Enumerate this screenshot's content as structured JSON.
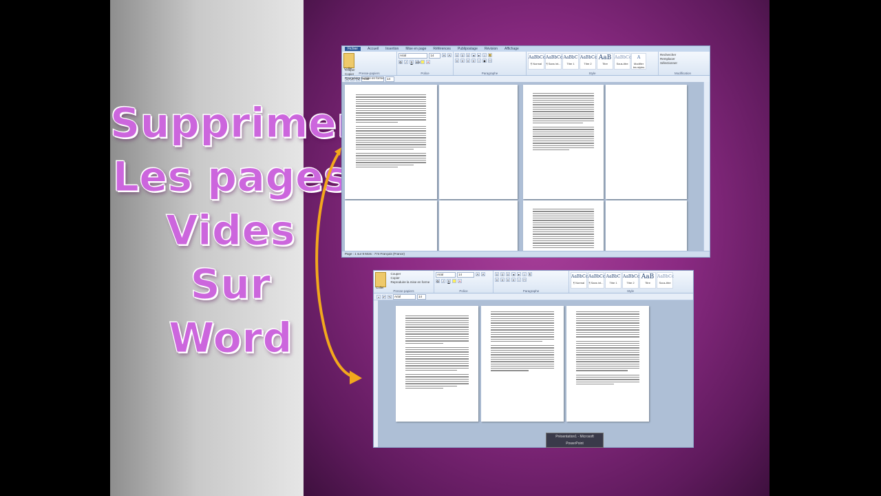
{
  "title": {
    "lines": [
      "Supprimer",
      "Les pages",
      "Vides",
      "Sur",
      "Word"
    ]
  },
  "word_top": {
    "tabs": [
      "Fichier",
      "Accueil",
      "Insertion",
      "Mise en page",
      "Références",
      "Publipostage",
      "Révision",
      "Affichage"
    ],
    "clipboard": {
      "paste": "Coller",
      "cut": "Couper",
      "copy": "Copier",
      "format_painter": "Reproduire la mise en forme",
      "group_label": "Presse-papiers"
    },
    "font": {
      "name": "Arial",
      "size": "14",
      "group_label": "Police"
    },
    "paragraph": {
      "group_label": "Paragraphe"
    },
    "styles": {
      "group_label": "Style",
      "items": [
        {
          "sample": "AaBbCcDc",
          "name": "¶ Normal"
        },
        {
          "sample": "AaBbCcDc",
          "name": "¶ Sans int..."
        },
        {
          "sample": "AaBbC",
          "name": "Titre 1"
        },
        {
          "sample": "AaBbCc",
          "name": "Titre 2"
        },
        {
          "sample": "AaB",
          "name": "Titre"
        },
        {
          "sample": "AaBbCc.",
          "name": "Sous-titre"
        }
      ],
      "change": "Modifier les styles"
    },
    "editing": {
      "group_label": "Modification",
      "find": "Rechercher",
      "replace": "Remplacer",
      "select": "Sélectionner"
    },
    "status_text": "Page : 1 sur 9   Mots : 774   Français (France)"
  },
  "word_bottom": {
    "clipboard": {
      "cut": "Couper",
      "copy": "Copier",
      "format_painter": "Reproduire la mise en forme",
      "paste": "Coller",
      "group_label": "Presse-papiers"
    },
    "font": {
      "name": "Arial",
      "size": "14",
      "group_label": "Police"
    },
    "paragraph": {
      "group_label": "Paragraphe"
    },
    "styles": {
      "group_label": "Style",
      "items": [
        {
          "sample": "AaBbCcDc",
          "name": "¶ Normal"
        },
        {
          "sample": "AaBbCcDc",
          "name": "¶ Sans int..."
        },
        {
          "sample": "AaBbC",
          "name": "Titre 1"
        },
        {
          "sample": "AaBbCc",
          "name": "Titre 2"
        },
        {
          "sample": "AaB",
          "name": "Titre"
        },
        {
          "sample": "AaBbCc",
          "name": "Sous-titre"
        }
      ]
    }
  },
  "taskbar": {
    "label": "Présentation1 - Microsoft PowerPoint"
  },
  "colors": {
    "title": "#cc66dd",
    "arrow": "#f2a81d",
    "purple": "#8a2a82"
  }
}
